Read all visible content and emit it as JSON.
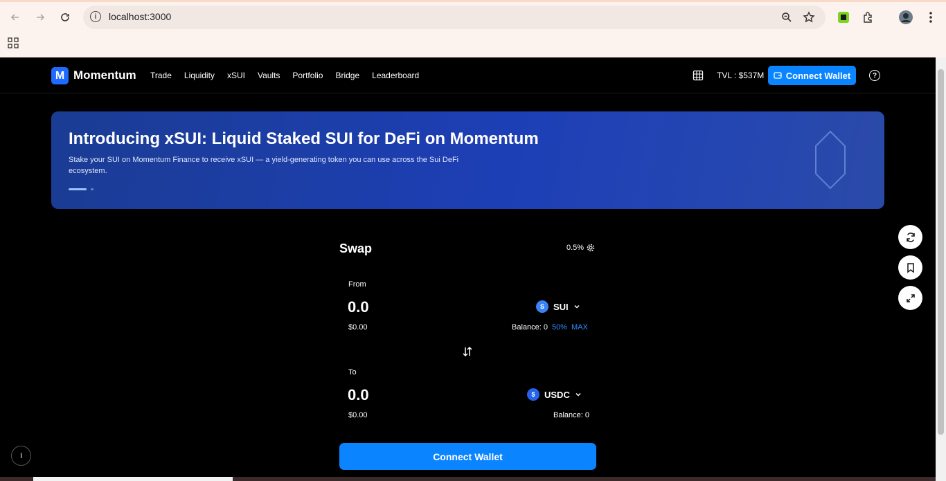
{
  "browser": {
    "url": "localhost:3000",
    "icons": [
      "back-icon",
      "forward-icon",
      "reload-icon",
      "info-icon",
      "zoom-icon",
      "star-icon",
      "extension-icon",
      "puzzle-icon",
      "profile-icon",
      "menu-icon",
      "apps-icon"
    ]
  },
  "header": {
    "logo_letter": "M",
    "brand": "Momentum",
    "nav": [
      "Trade",
      "Liquidity",
      "xSUI",
      "Vaults",
      "Portfolio",
      "Bridge",
      "Leaderboard"
    ],
    "tvl": "TVL : $537M",
    "connect_label": "Connect Wallet",
    "help": "?"
  },
  "banner": {
    "title": "Introducing xSUI: Liquid Staked SUI for DeFi on Momentum",
    "description": "Stake your SUI on Momentum Finance to receive xSUI — a yield-generating token you can use across the Sui DeFi ecosystem."
  },
  "swap": {
    "title": "Swap",
    "slippage": "0.5%",
    "from": {
      "label": "From",
      "amount": "0.0",
      "usd": "$0.00",
      "token": "SUI",
      "token_icon": "S",
      "balance": "Balance: 0",
      "half": "50%",
      "max": "MAX"
    },
    "to": {
      "label": "To",
      "amount": "0.0",
      "usd": "$0.00",
      "token": "USDC",
      "token_icon": "$",
      "balance": "Balance: 0"
    },
    "connect_label": "Connect Wallet"
  },
  "side_buttons": [
    "refresh-icon",
    "bookmark-icon",
    "expand-icon"
  ],
  "bottom_badge": "I",
  "colors": {
    "accent": "#0a84ff",
    "logo": "#1f6bff",
    "link": "#2f8cff",
    "background": "#000000"
  }
}
